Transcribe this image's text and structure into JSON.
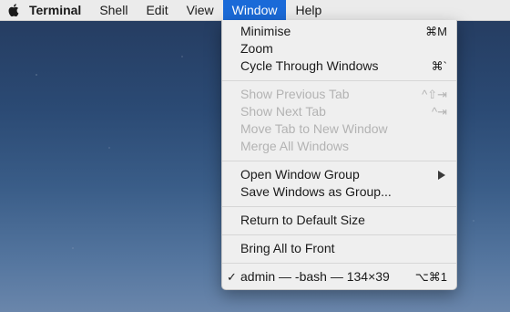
{
  "menubar": {
    "app_name": "Terminal",
    "items": [
      "Shell",
      "Edit",
      "View"
    ],
    "active_menu": "Window",
    "help": "Help"
  },
  "window_menu": {
    "items": [
      {
        "label": "Minimise",
        "shortcut": "⌘M"
      },
      {
        "label": "Zoom",
        "shortcut": ""
      },
      {
        "label": "Cycle Through Windows",
        "shortcut": "⌘`"
      },
      {
        "label": "Show Previous Tab",
        "shortcut": "^⇧⇥",
        "disabled": true
      },
      {
        "label": "Show Next Tab",
        "shortcut": "^⇥",
        "disabled": true
      },
      {
        "label": "Move Tab to New Window",
        "shortcut": "",
        "disabled": true
      },
      {
        "label": "Merge All Windows",
        "shortcut": "",
        "disabled": true
      },
      {
        "label": "Open Window Group",
        "submenu": true
      },
      {
        "label": "Save Windows as Group...",
        "shortcut": ""
      },
      {
        "label": "Return to Default Size",
        "shortcut": ""
      },
      {
        "label": "Bring All to Front",
        "shortcut": ""
      },
      {
        "label": "admin — -bash — 134×39",
        "shortcut": "⌥⌘1",
        "checked": true
      }
    ]
  },
  "colors": {
    "menubar_bg": "#ebebeb",
    "highlight": "#1a6ad8",
    "menu_bg": "#efefef",
    "disabled_text": "#b3b3b3"
  }
}
